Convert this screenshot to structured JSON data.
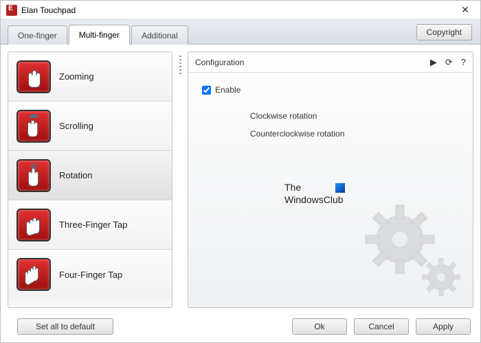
{
  "window": {
    "title": "Elan Touchpad",
    "close_glyph": "✕"
  },
  "tabs": {
    "items": [
      {
        "label": "One-finger",
        "active": false
      },
      {
        "label": "Multi-finger",
        "active": true
      },
      {
        "label": "Additional",
        "active": false
      }
    ],
    "copyright_label": "Copyright"
  },
  "sidebar": {
    "items": [
      {
        "label": "Zooming",
        "icon": "zoom-gesture-icon",
        "selected": false
      },
      {
        "label": "Scrolling",
        "icon": "scroll-gesture-icon",
        "selected": false
      },
      {
        "label": "Rotation",
        "icon": "rotation-gesture-icon",
        "selected": true
      },
      {
        "label": "Three-Finger Tap",
        "icon": "three-finger-tap-icon",
        "selected": false
      },
      {
        "label": "Four-Finger Tap",
        "icon": "four-finger-tap-icon",
        "selected": false
      }
    ]
  },
  "config": {
    "header_title": "Configuration",
    "play_glyph": "▶",
    "refresh_glyph": "⟳",
    "help_glyph": "?",
    "enable_label": "Enable",
    "enable_checked": true,
    "options": [
      "Clockwise rotation",
      "Counterclockwise rotation"
    ]
  },
  "watermark": {
    "line1": "The",
    "line2": "WindowsClub"
  },
  "buttons": {
    "set_default": "Set all to default",
    "ok": "Ok",
    "cancel": "Cancel",
    "apply": "Apply"
  }
}
